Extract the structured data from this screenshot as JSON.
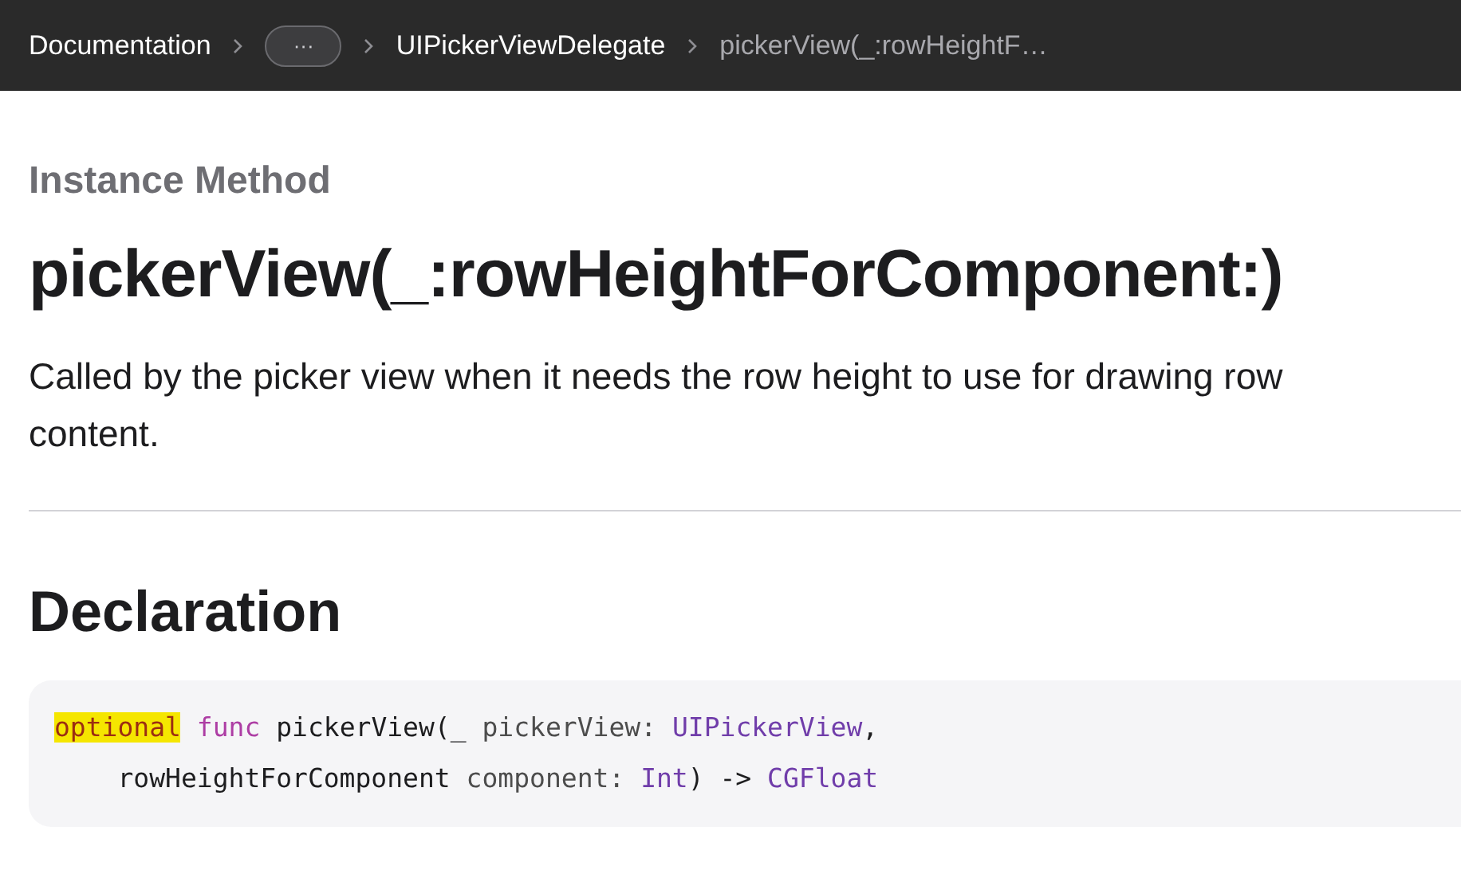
{
  "breadcrumbs": [
    {
      "kind": "link",
      "label": "Documentation"
    },
    {
      "kind": "ellipsis",
      "label": "···"
    },
    {
      "kind": "link",
      "label": "UIPickerViewDelegate"
    },
    {
      "kind": "current",
      "label": "pickerView(_:rowHeightF…"
    }
  ],
  "eyebrow": "Instance Method",
  "title": "pickerView(_:rowHeightForComponent:)",
  "abstract": "Called by the picker view when it needs the row height to use for drawing row content.",
  "section_title": "Declaration",
  "declaration": [
    [
      {
        "kind": "keyword",
        "text": "optional",
        "highlighted": true
      },
      {
        "kind": "keyword",
        "text": " func",
        "highlighted": false
      },
      {
        "kind": "plain",
        "text": " pickerView(_ "
      },
      {
        "kind": "param",
        "text": "pickerView: "
      },
      {
        "kind": "type",
        "text": "UIPickerView"
      },
      {
        "kind": "plain",
        "text": ","
      }
    ],
    [
      {
        "kind": "plain",
        "text": "    rowHeightForComponent "
      },
      {
        "kind": "param",
        "text": "component: "
      },
      {
        "kind": "type",
        "text": "Int"
      },
      {
        "kind": "plain",
        "text": ") -> "
      },
      {
        "kind": "type",
        "text": "CGFloat"
      }
    ]
  ]
}
